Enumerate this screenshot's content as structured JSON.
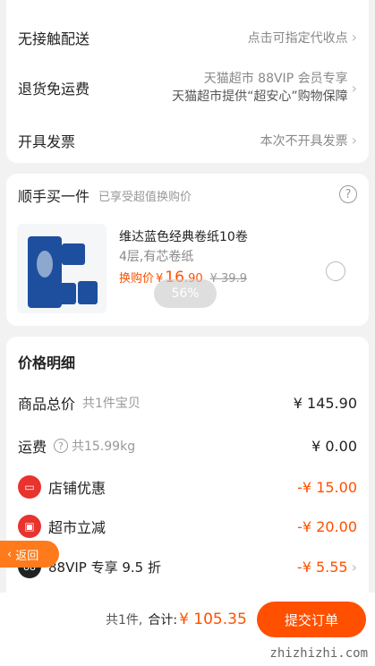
{
  "delivery": {
    "contactless_label": "无接触配送",
    "contactless_value": "点击可指定代收点",
    "return_label": "退货免运费",
    "return_value_line1": "天猫超市 88VIP 会员专享",
    "return_value_line2": "天猫超市提供“超安心”购物保障",
    "invoice_label": "开具发票",
    "invoice_value": "本次不开具发票"
  },
  "addon": {
    "title": "顺手买一件",
    "subtitle": "已享受超值换购价",
    "product_name": "维达蓝色经典卷纸10卷",
    "product_spec": "4层,有芯卷纸",
    "price_prefix": "换购价",
    "price_currency": "¥",
    "price_int": "16",
    "price_dec": ".90",
    "original_price": "¥ 39.9",
    "progress_badge": "56%"
  },
  "price_detail": {
    "title": "价格明细",
    "goods_total_label": "商品总价",
    "goods_total_sub": "共1件宝贝",
    "goods_total_value": "¥ 145.90",
    "shipping_label": "运费",
    "shipping_sub": "共15.99kg",
    "shipping_value": "¥ 0.00",
    "store_discount_label": "店铺优惠",
    "store_discount_value": "-¥ 15.00",
    "market_discount_label": "超市立减",
    "market_discount_value": "-¥ 20.00",
    "vip_label": "88VIP 专享 9.5 折",
    "vip_value": "-¥ 5.55"
  },
  "footer": {
    "count": "共1件,",
    "total_label": "合计:",
    "total_value": "¥ 105.35",
    "submit": "提交订单",
    "back": "返回"
  },
  "watermark": "zhizhizhi.com"
}
